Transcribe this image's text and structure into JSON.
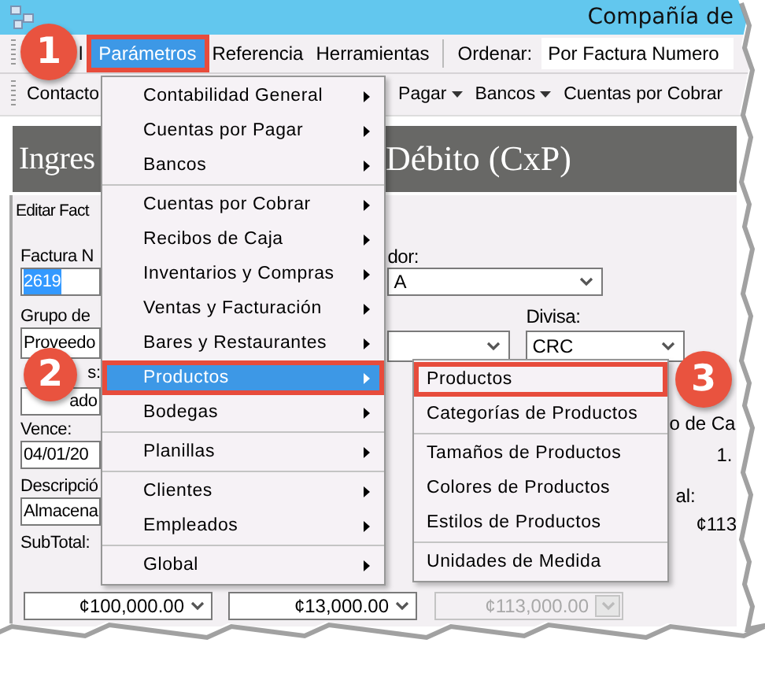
{
  "window": {
    "title": "Compañía de"
  },
  "menu_bar": {
    "items": [
      {
        "label": "l",
        "selected": false,
        "outlined": false
      },
      {
        "label": "Parámetros",
        "selected": true,
        "outlined": true
      },
      {
        "label": "Referencia",
        "selected": false,
        "outlined": false
      },
      {
        "label": "Herramientas",
        "selected": false,
        "outlined": false
      }
    ],
    "sort_label": "Ordenar:",
    "sort_value": "Por Factura Numero"
  },
  "toolbar": {
    "items": [
      {
        "label": "Contacto",
        "dropdown": false
      },
      {
        "label": "Pagar",
        "dropdown": true
      },
      {
        "label": "Bancos",
        "dropdown": true
      },
      {
        "label": "Cuentas por Cobrar",
        "dropdown": false
      }
    ]
  },
  "banner": {
    "title_left": "Ingres",
    "title_right": "Débito (CxP)"
  },
  "form": {
    "tab": "Editar Fact",
    "left": [
      {
        "kind": "label",
        "text": "Factura N"
      },
      {
        "kind": "field",
        "value": "2619",
        "selected": true
      },
      {
        "kind": "label",
        "text": "Grupo de"
      },
      {
        "kind": "field",
        "value": "Proveedo",
        "selected": false
      },
      {
        "kind": "tail_label",
        "text": "s:"
      },
      {
        "kind": "tail_field",
        "value": "ado",
        "selected": false
      },
      {
        "kind": "label",
        "text": "Vence:"
      },
      {
        "kind": "field",
        "value": "04/01/20",
        "selected": false
      },
      {
        "kind": "label",
        "text": "Descripció"
      },
      {
        "kind": "field",
        "value": "Almacena",
        "selected": false
      },
      {
        "kind": "label",
        "text": "SubTotal:"
      }
    ],
    "supplier_label": "dor:",
    "supplier_value": "A",
    "currency_label": "Divisa:",
    "currency_value": "CRC",
    "notes": [
      "o de Ca",
      "1.",
      "al:",
      "¢113"
    ],
    "totals": [
      {
        "value": "¢100,000.00",
        "disabled": false
      },
      {
        "value": "¢13,000.00",
        "disabled": false
      },
      {
        "value": "¢113,000.00",
        "disabled": true
      }
    ]
  },
  "menu": {
    "items": [
      {
        "kind": "item",
        "label": "Contabilidad General",
        "has_submenu": true,
        "selected": false,
        "outlined": false
      },
      {
        "kind": "item",
        "label": "Cuentas por Pagar",
        "has_submenu": true,
        "selected": false,
        "outlined": false
      },
      {
        "kind": "item",
        "label": "Bancos",
        "has_submenu": true,
        "selected": false,
        "outlined": false
      },
      {
        "kind": "separator"
      },
      {
        "kind": "item",
        "label": "Cuentas por Cobrar",
        "has_submenu": true,
        "selected": false,
        "outlined": false
      },
      {
        "kind": "item",
        "label": "Recibos de Caja",
        "has_submenu": true,
        "selected": false,
        "outlined": false
      },
      {
        "kind": "item",
        "label": "Inventarios y Compras",
        "has_submenu": true,
        "selected": false,
        "outlined": false
      },
      {
        "kind": "item",
        "label": "Ventas y Facturación",
        "has_submenu": true,
        "selected": false,
        "outlined": false
      },
      {
        "kind": "item",
        "label": "Bares y Restaurantes",
        "has_submenu": true,
        "selected": false,
        "outlined": false
      },
      {
        "kind": "item",
        "label": "Productos",
        "has_submenu": true,
        "selected": true,
        "outlined": true
      },
      {
        "kind": "item",
        "label": "Bodegas",
        "has_submenu": true,
        "selected": false,
        "outlined": false
      },
      {
        "kind": "separator"
      },
      {
        "kind": "item",
        "label": "Planillas",
        "has_submenu": true,
        "selected": false,
        "outlined": false
      },
      {
        "kind": "separator"
      },
      {
        "kind": "item",
        "label": "Clientes",
        "has_submenu": true,
        "selected": false,
        "outlined": false
      },
      {
        "kind": "item",
        "label": "Empleados",
        "has_submenu": true,
        "selected": false,
        "outlined": false
      },
      {
        "kind": "separator"
      },
      {
        "kind": "item",
        "label": "Global",
        "has_submenu": true,
        "selected": false,
        "outlined": false
      }
    ]
  },
  "submenu": {
    "items": [
      {
        "kind": "item",
        "label": "Productos",
        "selected": false,
        "outlined": true
      },
      {
        "kind": "item",
        "label": "Categorías de Productos",
        "selected": false,
        "outlined": false
      },
      {
        "kind": "separator"
      },
      {
        "kind": "item",
        "label": "Tamaños de Productos",
        "selected": false,
        "outlined": false
      },
      {
        "kind": "item",
        "label": "Colores de Productos",
        "selected": false,
        "outlined": false
      },
      {
        "kind": "item",
        "label": "Estilos de Productos",
        "selected": false,
        "outlined": false
      },
      {
        "kind": "separator"
      },
      {
        "kind": "item",
        "label": "Unidades de Medida",
        "selected": false,
        "outlined": false
      }
    ]
  },
  "callouts": [
    {
      "number": "1"
    },
    {
      "number": "2"
    },
    {
      "number": "3"
    }
  ]
}
